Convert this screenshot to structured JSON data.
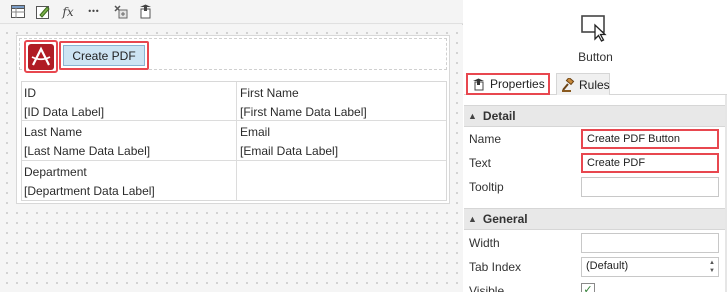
{
  "toolbar": {
    "icons": [
      "table-icon",
      "edit-form-icon",
      "function-icon",
      "more-icon",
      "tools-icon",
      "rules-icon"
    ],
    "fx_glyph": "fx",
    "more_glyph": "•••"
  },
  "designer": {
    "button_label": "Create PDF",
    "fields": [
      {
        "label": "ID",
        "value": "[ID Data Label]"
      },
      {
        "label": "First Name",
        "value": "[First Name Data Label]"
      },
      {
        "label": "Last Name",
        "value": "[Last Name Data Label]"
      },
      {
        "label": "Email",
        "value": "[Email Data Label]"
      },
      {
        "label": "Department",
        "value": "[Department Data Label]"
      }
    ]
  },
  "panel": {
    "control_type": "Button",
    "tabs": [
      {
        "label": "Properties",
        "active": true
      },
      {
        "label": "Rules",
        "active": false
      }
    ],
    "sections": {
      "detail": "Detail",
      "general": "General"
    },
    "properties": {
      "name": {
        "label": "Name",
        "value": "Create PDF Button"
      },
      "text": {
        "label": "Text",
        "value": "Create PDF"
      },
      "tooltip": {
        "label": "Tooltip",
        "value": ""
      },
      "width": {
        "label": "Width",
        "value": ""
      },
      "tab_index": {
        "label": "Tab Index",
        "value": "(Default)"
      },
      "visible": {
        "label": "Visible",
        "checked": true
      }
    }
  },
  "colors": {
    "highlight": "#e8474f",
    "button_fill": "#cde4f3",
    "section_bg": "#e8e8e8"
  }
}
